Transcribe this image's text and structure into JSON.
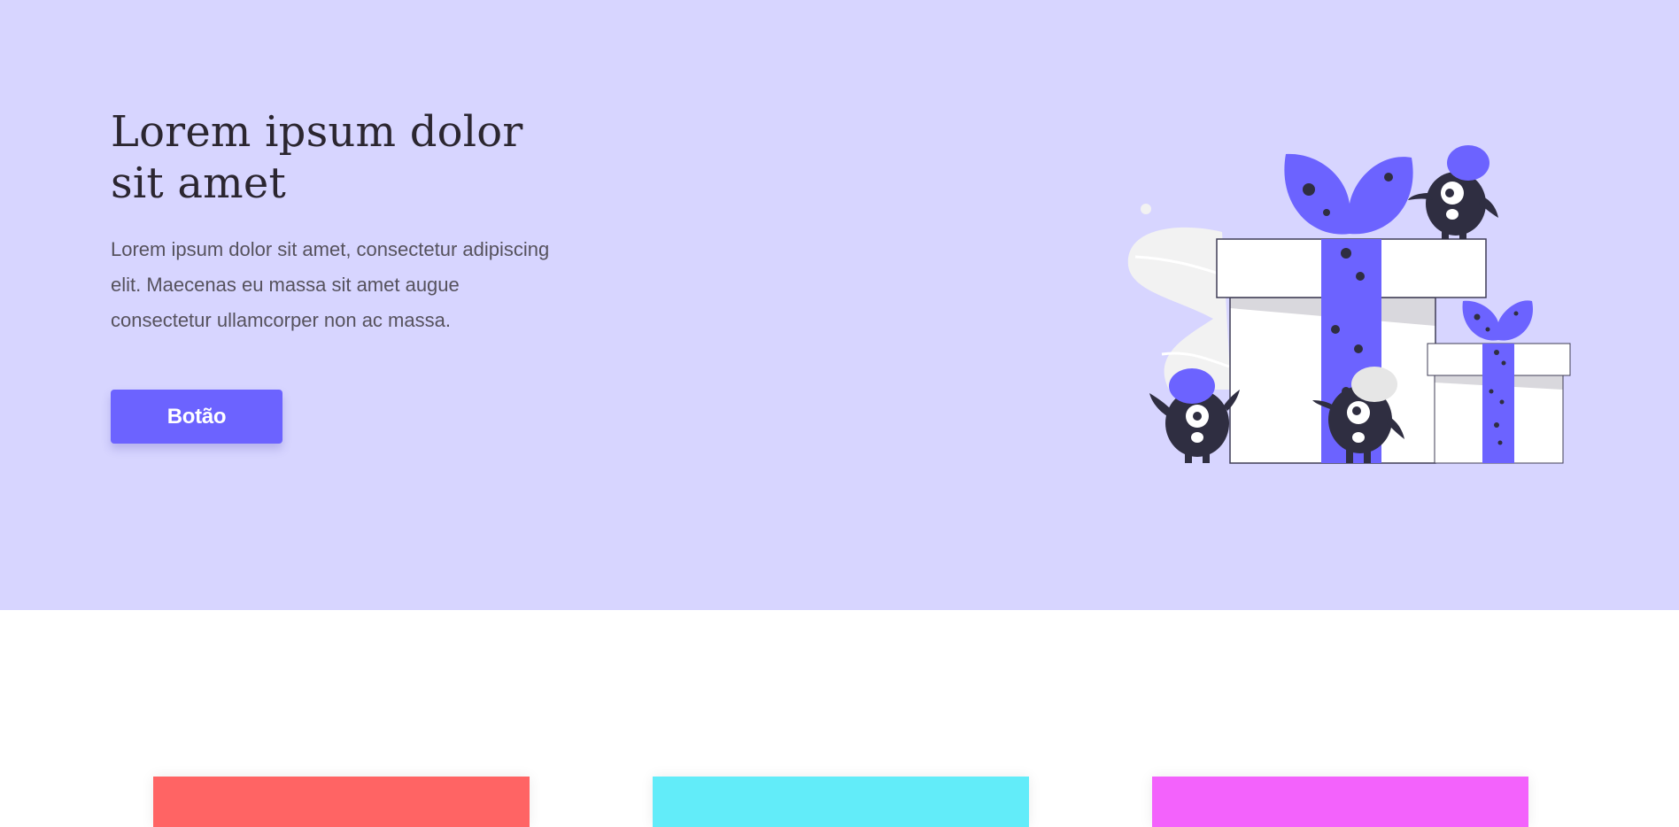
{
  "hero": {
    "title": "Lorem ipsum dolor sit amet",
    "description": "Lorem ipsum dolor sit amet, consectetur adipiscing elit. Maecenas eu massa sit amet augue consectetur ullamcorper non ac massa.",
    "button_label": "Botão"
  },
  "illustration": {
    "icon": "gift-boxes-monsters-illustration"
  },
  "colors": {
    "hero_background": "#d7d5ff",
    "accent": "#6c63ff",
    "card_1": "#ff6464",
    "card_2": "#62ecf9",
    "card_3": "#f362fc"
  },
  "cards": [
    {
      "color": "#ff6464"
    },
    {
      "color": "#62ecf9"
    },
    {
      "color": "#f362fc"
    }
  ]
}
